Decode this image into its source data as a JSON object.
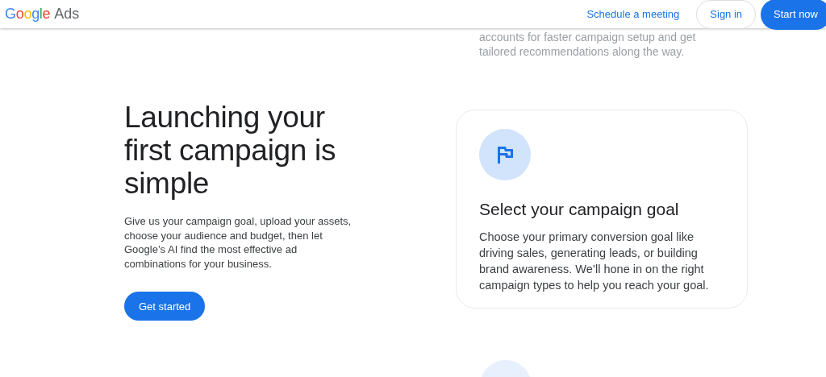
{
  "header": {
    "logo_brand": "Google",
    "logo_product": "Ads",
    "links": [
      {
        "label": "Schedule a meeting",
        "kind": "link"
      },
      {
        "label": "Sign in",
        "kind": "outline"
      },
      {
        "label": "Start now",
        "kind": "filled"
      }
    ]
  },
  "faded_text": [
    "accounts for faster campaign setup and get",
    "tailored recommendations along the way."
  ],
  "intro": {
    "title": "Launching your first campaign is simple",
    "description": "Give us your campaign goal, upload your assets, choose your audience and budget, then let Google’s AI find the most effective ad combinations for your business.",
    "button": "Get started"
  },
  "card": {
    "title": "Select your campaign goal",
    "description": "Choose your primary conversion goal like driving sales, generating leads, or building brand awareness. We’ll hone in on the right campaign types to help you reach your goal."
  }
}
